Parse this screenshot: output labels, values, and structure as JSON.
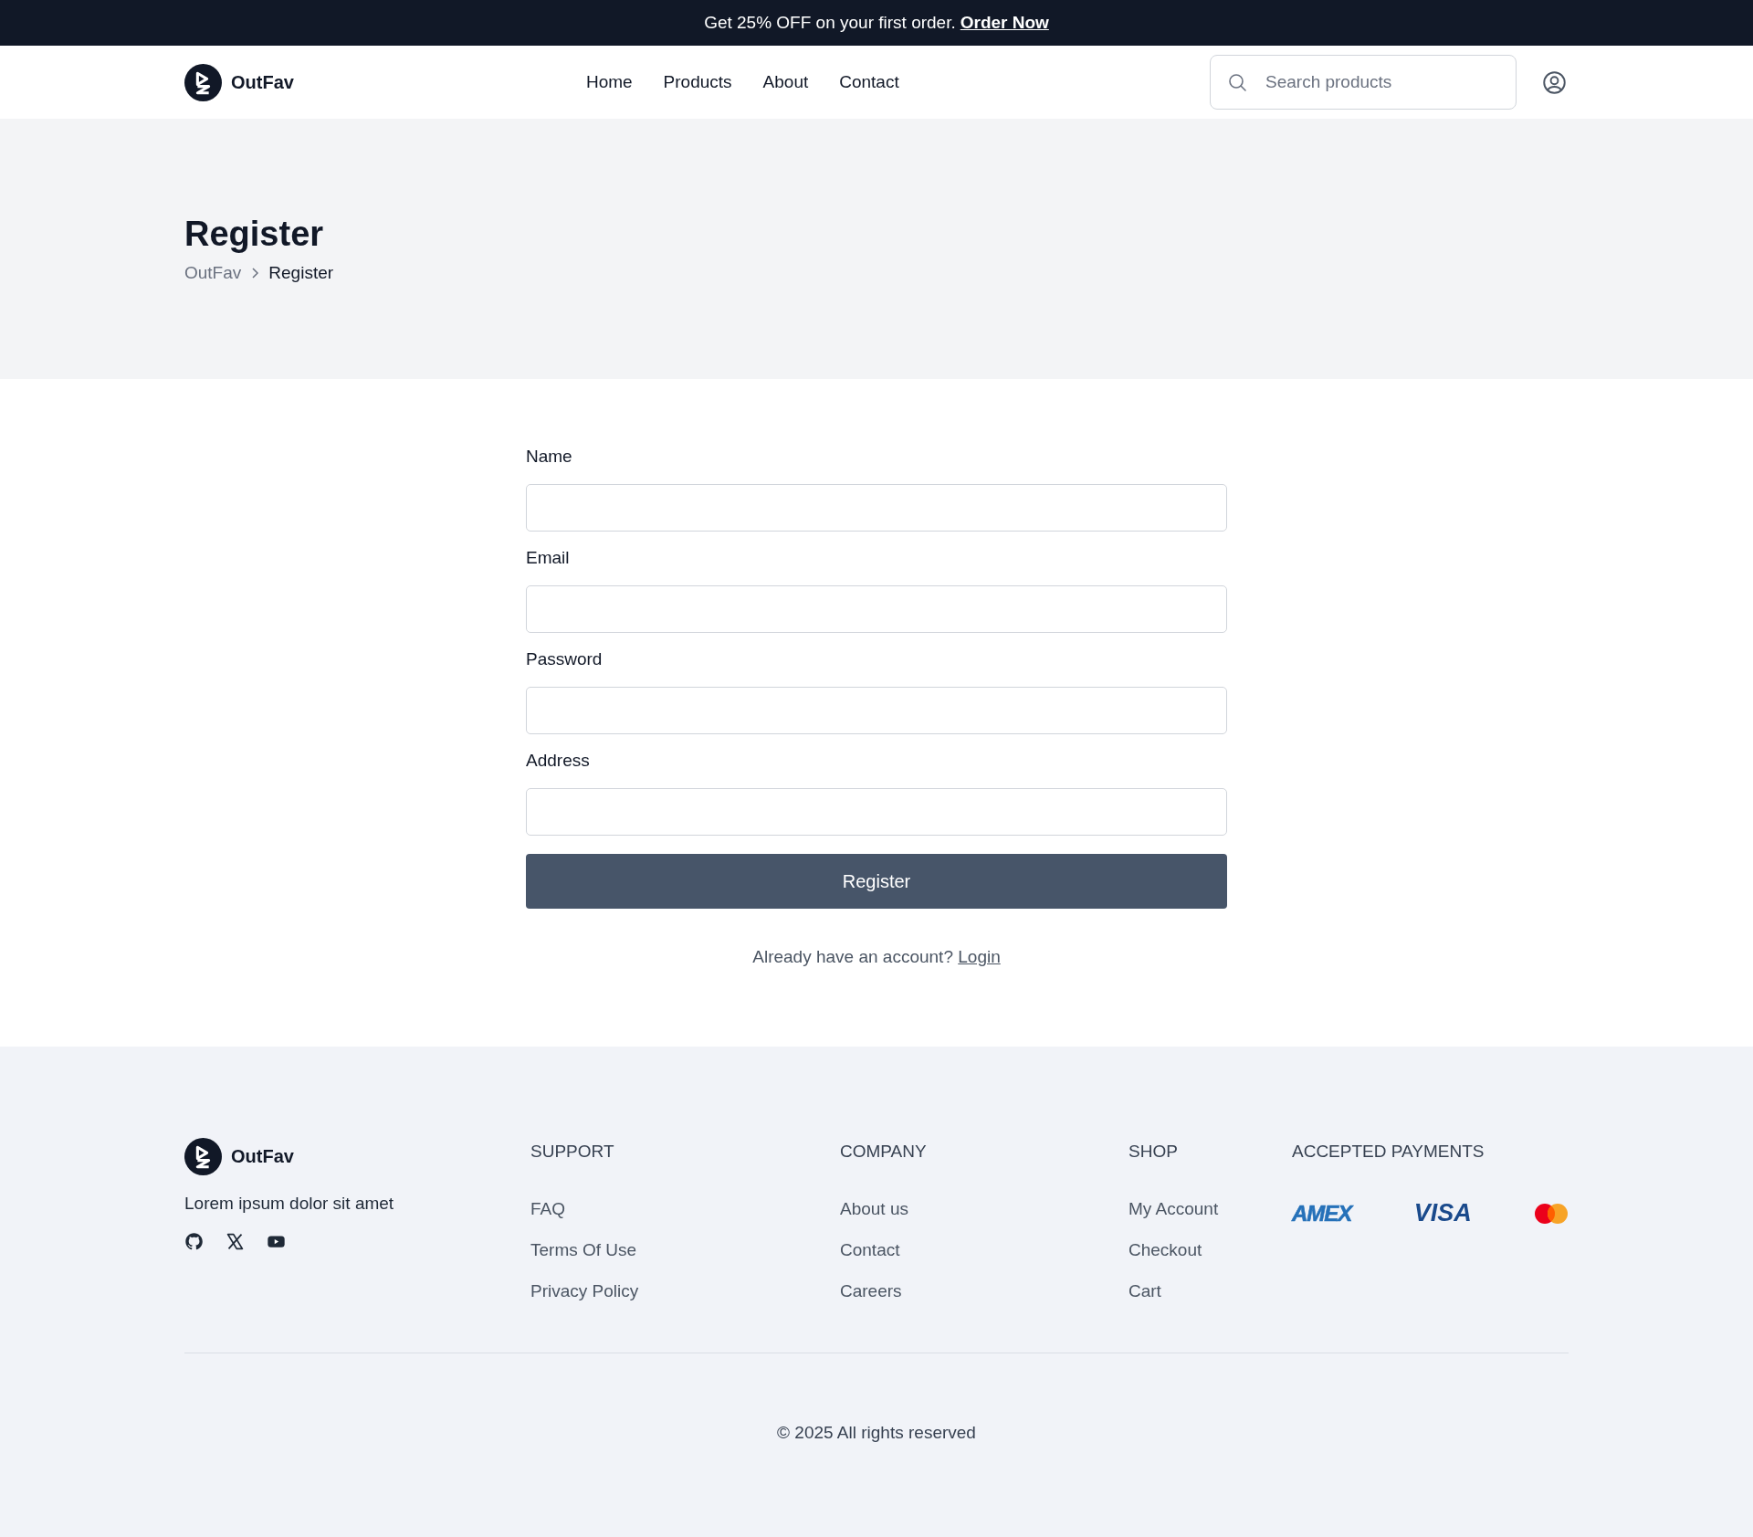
{
  "promo_bar": {
    "text": "Get 25% OFF on your first order.",
    "link": "Order Now"
  },
  "header": {
    "brand": "OutFav",
    "nav": [
      {
        "label": "Home"
      },
      {
        "label": "Products"
      },
      {
        "label": "About"
      },
      {
        "label": "Contact"
      }
    ],
    "search": {
      "placeholder": "Search products"
    }
  },
  "hero": {
    "title": "Register",
    "breadcrumb": [
      {
        "label": "OutFav",
        "current": false
      },
      {
        "label": "Register",
        "current": true
      }
    ]
  },
  "form": {
    "fields": [
      {
        "label": "Name"
      },
      {
        "label": "Email"
      },
      {
        "label": "Password"
      },
      {
        "label": "Address"
      }
    ],
    "submit": "Register",
    "login_prompt": "Already have an account?",
    "login_link": "Login"
  },
  "footer": {
    "brand": "OutFav",
    "tagline": "Lorem ipsum dolor sit amet",
    "social": [
      {
        "kind": "github"
      },
      {
        "kind": "x"
      },
      {
        "kind": "youtube"
      }
    ],
    "columns": [
      {
        "heading": "SUPPORT",
        "links": [
          "FAQ",
          "Terms Of Use",
          "Privacy Policy"
        ]
      },
      {
        "heading": "COMPANY",
        "links": [
          "About us",
          "Contact",
          "Careers"
        ]
      },
      {
        "heading": "SHOP",
        "links": [
          "My Account",
          "Checkout",
          "Cart"
        ]
      }
    ],
    "payments": {
      "heading": "ACCEPTED PAYMENTS",
      "methods": [
        {
          "kind": "amex",
          "label": "AMEX"
        },
        {
          "kind": "visa",
          "label": "VISA"
        },
        {
          "kind": "mastercard"
        }
      ]
    },
    "copyright": "© 2025 All rights reserved"
  }
}
